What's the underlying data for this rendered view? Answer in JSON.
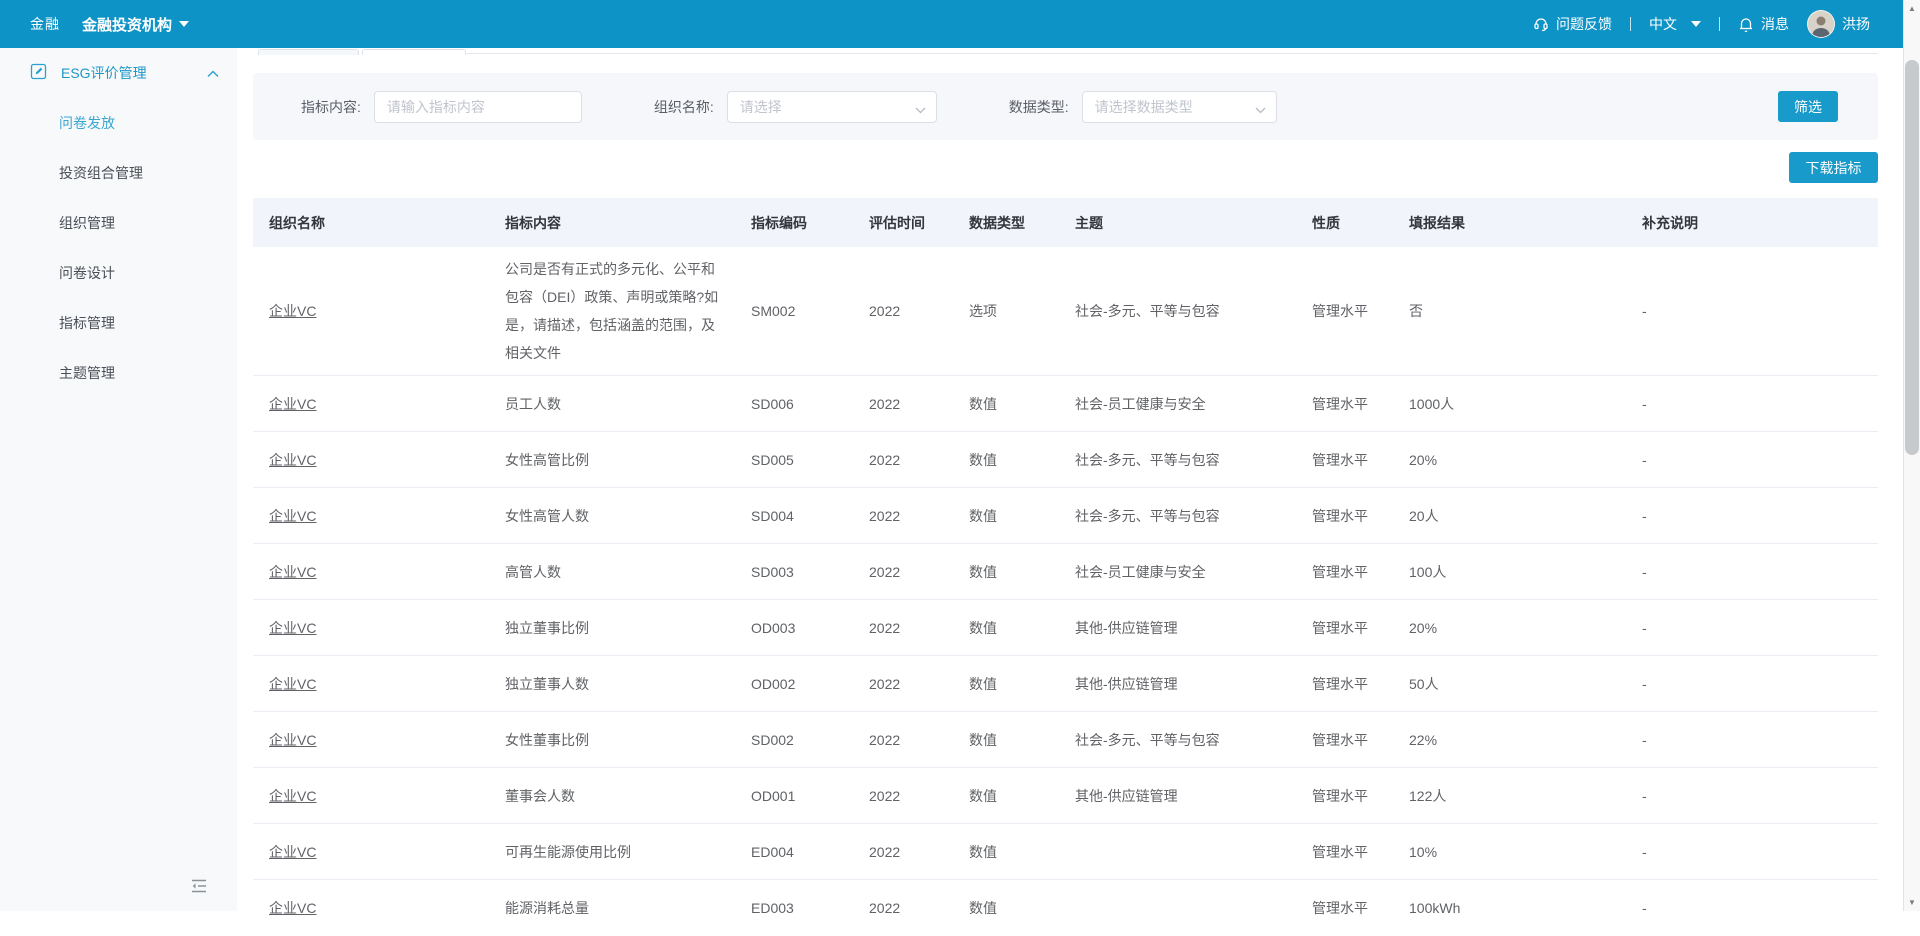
{
  "colors": {
    "topbar": "#0d93c5",
    "primary_button": "#189aca",
    "sidebar_bg": "#f7f9fa",
    "active_menu_text": "#3ba6d0",
    "table_header_bg": "#f1f4fa",
    "filter_bg": "#f5f7fa"
  },
  "topbar": {
    "logo": "金融",
    "org": "金融投资机构",
    "feedback": "问题反馈",
    "language": "中文",
    "messages": "消息",
    "username": "洪扬"
  },
  "sidebar": {
    "section": "ESG评价管理",
    "items": [
      {
        "label": "问卷发放",
        "active": true
      },
      {
        "label": "投资组合管理",
        "active": false
      },
      {
        "label": "组织管理",
        "active": false
      },
      {
        "label": "问卷设计",
        "active": false
      },
      {
        "label": "指标管理",
        "active": false
      },
      {
        "label": "主题管理",
        "active": false
      }
    ]
  },
  "filters": {
    "fields": [
      {
        "label": "指标内容:",
        "placeholder": "请输入指标内容",
        "type": "text"
      },
      {
        "label": "组织名称:",
        "placeholder": "请选择",
        "type": "select"
      },
      {
        "label": "数据类型:",
        "placeholder": "请选择数据类型",
        "type": "select"
      }
    ],
    "submit": "筛选"
  },
  "actions": {
    "download": "下载指标"
  },
  "table": {
    "headers": [
      "组织名称",
      "指标内容",
      "指标编码",
      "评估时间",
      "数据类型",
      "主题",
      "性质",
      "填报结果",
      "补充说明"
    ],
    "rows": [
      [
        "企业VC",
        "公司是否有正式的多元化、公平和包容（DEI）政策、声明或策略?如是，请描述，包括涵盖的范围，及相关文件",
        "SM002",
        "2022",
        "选项",
        "社会-多元、平等与包容",
        "管理水平",
        "否",
        "-"
      ],
      [
        "企业VC",
        "员工人数",
        "SD006",
        "2022",
        "数值",
        "社会-员工健康与安全",
        "管理水平",
        "1000人",
        "-"
      ],
      [
        "企业VC",
        "女性高管比例",
        "SD005",
        "2022",
        "数值",
        "社会-多元、平等与包容",
        "管理水平",
        "20%",
        "-"
      ],
      [
        "企业VC",
        "女性高管人数",
        "SD004",
        "2022",
        "数值",
        "社会-多元、平等与包容",
        "管理水平",
        "20人",
        "-"
      ],
      [
        "企业VC",
        "高管人数",
        "SD003",
        "2022",
        "数值",
        "社会-员工健康与安全",
        "管理水平",
        "100人",
        "-"
      ],
      [
        "企业VC",
        "独立董事比例",
        "OD003",
        "2022",
        "数值",
        "其他-供应链管理",
        "管理水平",
        "20%",
        "-"
      ],
      [
        "企业VC",
        "独立董事人数",
        "OD002",
        "2022",
        "数值",
        "其他-供应链管理",
        "管理水平",
        "50人",
        "-"
      ],
      [
        "企业VC",
        "女性董事比例",
        "SD002",
        "2022",
        "数值",
        "社会-多元、平等与包容",
        "管理水平",
        "22%",
        "-"
      ],
      [
        "企业VC",
        "董事会人数",
        "OD001",
        "2022",
        "数值",
        "其他-供应链管理",
        "管理水平",
        "122人",
        "-"
      ],
      [
        "企业VC",
        "可再生能源使用比例",
        "ED004",
        "2022",
        "数值",
        "",
        "管理水平",
        "10%",
        "-"
      ],
      [
        "企业VC",
        "能源消耗总量",
        "ED003",
        "2022",
        "数值",
        "",
        "管理水平",
        "100kWh",
        "-"
      ]
    ]
  }
}
